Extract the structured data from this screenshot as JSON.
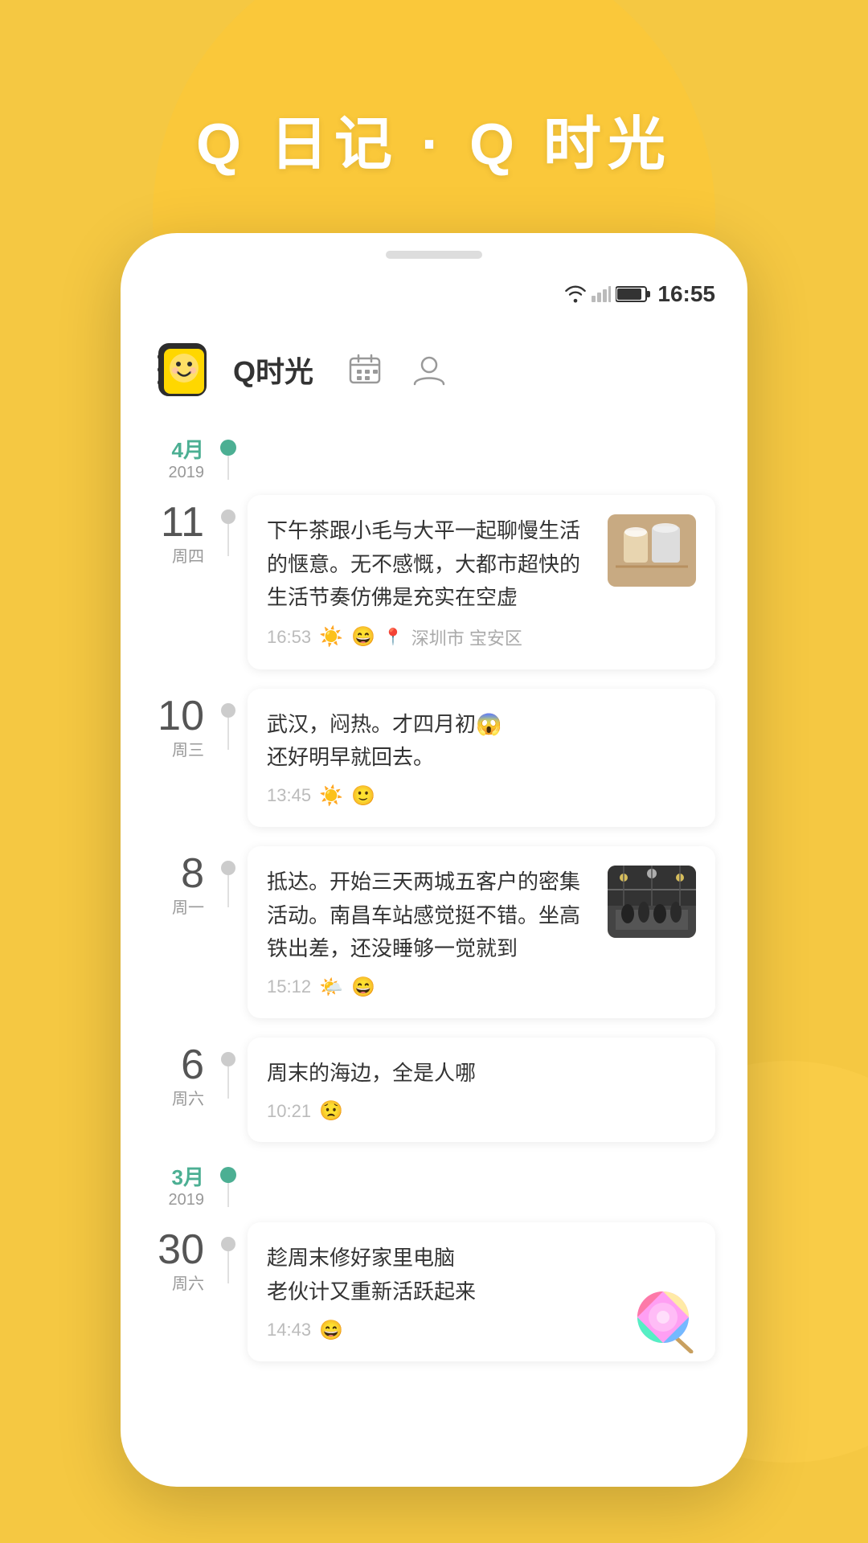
{
  "background": {
    "color": "#F5C842"
  },
  "app_title": "Q 日记 · Q 时光",
  "status_bar": {
    "time": "16:55"
  },
  "header": {
    "app_name": "Q时光",
    "calendar_icon": "📅",
    "user_icon": "👤"
  },
  "timeline": {
    "months": [
      {
        "id": "april-2019",
        "month": "4月",
        "year": "2019",
        "month_color": "#4CAF93",
        "entries": [
          {
            "id": "entry-apr-11",
            "day": "11",
            "weekday": "周四",
            "has_image": true,
            "image_type": "tea",
            "body": "下午茶跟小毛与大平一起聊慢生活的惬意。无不感慨，大都市超快的生活节奏仿佛是充实在空虚",
            "time": "16:53",
            "weather": "☀️",
            "mood": "😄",
            "location": "深圳市 宝安区",
            "has_location": true
          },
          {
            "id": "entry-apr-10",
            "day": "10",
            "weekday": "周三",
            "has_image": false,
            "body": "武汉，闷热。才四月初😱\n还好明早就回去。",
            "time": "13:45",
            "weather": "☀️",
            "mood": "🙂",
            "has_location": false
          },
          {
            "id": "entry-apr-8",
            "day": "8",
            "weekday": "周一",
            "has_image": true,
            "image_type": "station",
            "body": "抵达。开始三天两城五客户的密集活动。南昌车站感觉挺不错。坐高铁出差，还没睡够一觉就到",
            "time": "15:12",
            "weather": "🌤️",
            "mood": "😄",
            "has_location": false
          },
          {
            "id": "entry-apr-6",
            "day": "6",
            "weekday": "周六",
            "has_image": false,
            "body": "周末的海边，全是人哪",
            "time": "10:21",
            "weather": "",
            "mood": "😟",
            "has_location": false
          }
        ]
      },
      {
        "id": "march-2019",
        "month": "3月",
        "year": "2019",
        "month_color": "#4CAF93",
        "entries": [
          {
            "id": "entry-mar-30",
            "day": "30",
            "weekday": "周六",
            "has_image": true,
            "image_type": "lollipop",
            "body": "趁周末修好家里电脑\n老伙计又重新活跃起来",
            "time": "14:43",
            "weather": "",
            "mood": "😄",
            "has_location": false
          }
        ]
      }
    ]
  }
}
